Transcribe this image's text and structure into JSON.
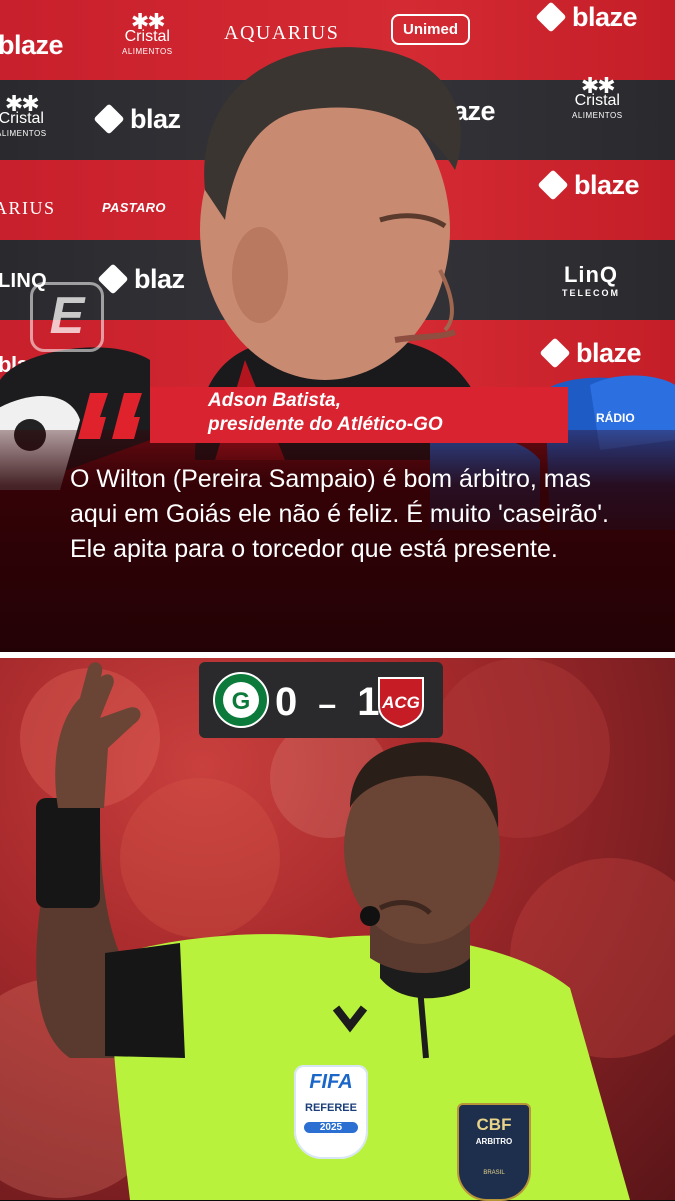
{
  "sponsors": {
    "blaze": "blaze",
    "blaze_partial_1": "blaze",
    "blaze_partial_2": "blaz",
    "blaze_partial_3": "blaze",
    "cristal": "Cristal",
    "cristal_sub": "ALIMENTOS",
    "aquarius": "AQUARIUS",
    "aquarius_partial": "ARIUS",
    "unimed": "Unimed",
    "pastaro": "PASTARO",
    "linq": "LinQ",
    "linq_sub": "TELECOM",
    "linq_partial": "LINQ"
  },
  "quote": {
    "speaker_name": "Adson Batista,",
    "speaker_role": "presidente do Atlético-GO",
    "text": "O Wilton (Pereira Sampaio) é bom árbitro, mas aqui em Goiás ele não é feliz. É muito 'caseirão'. Ele apita para o torcedor que está presente."
  },
  "scoreboard": {
    "home_goals": "0",
    "separator": "–",
    "away_goals": "1",
    "home_crest_letter": "G",
    "away_crest_letters": "ACG"
  },
  "badges": {
    "fifa": "FIFA",
    "referee": "REFEREE",
    "year": "2025",
    "cbf": "CBF",
    "arbitro": "ARBITRO",
    "brasil": "BRASIL"
  },
  "colors": {
    "accent_red": "#d92330",
    "quote_mark_red": "#e0222d",
    "referee_shirt": "#b8f23c",
    "scoreboard_bg": "#2a2a2c"
  },
  "icons": [
    "espn-logo-icon",
    "quote-mark-icon",
    "goias-crest-icon",
    "atletico-go-crest-icon"
  ]
}
